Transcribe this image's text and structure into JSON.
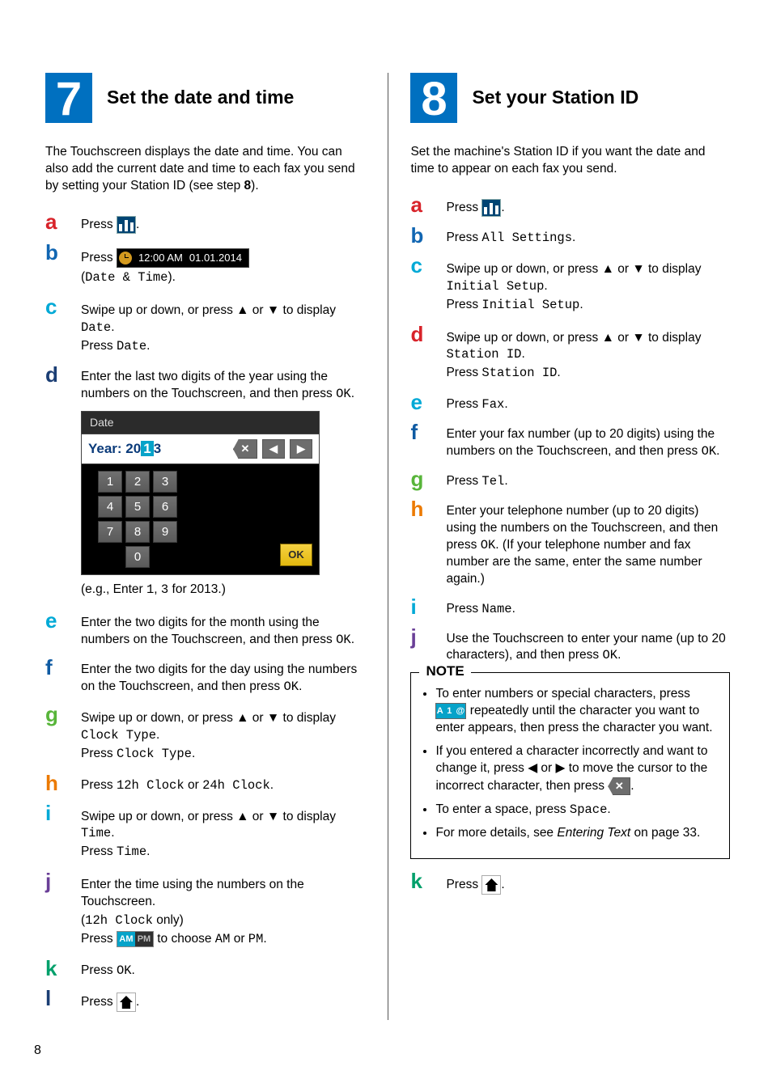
{
  "page_number": "8",
  "left": {
    "number": "7",
    "title": "Set the date and time",
    "intro_a": "The Touchscreen displays the date and time. You can also add the current date and time to each fax you send by setting your Station ID (see step ",
    "intro_bold": "8",
    "intro_b": ").",
    "steps": {
      "a": {
        "pre": "Press ",
        "post": "."
      },
      "b": {
        "pre": "Press ",
        "pill_time": "12:00 AM",
        "pill_date": "01.01.2014",
        "line2a": "(",
        "line2_mono": "Date & Time",
        "line2b": ")."
      },
      "c": {
        "line1a": "Swipe up or down, or press ▲ or ▼ to display ",
        "line1_mono": "Date",
        "line1b": ".",
        "line2a": "Press ",
        "line2_mono": "Date",
        "line2b": "."
      },
      "d": {
        "text_a": "Enter the last two digits of the year using the numbers on the Touchscreen, and then press ",
        "text_mono": "OK",
        "text_b": "."
      },
      "date_shot": {
        "title": "Date",
        "year_prefix": "Year: 20",
        "year_caret": "1",
        "year_suffix": "3",
        "keys": [
          "1",
          "2",
          "3",
          "4",
          "5",
          "6",
          "7",
          "8",
          "9",
          "0"
        ],
        "ok": "OK"
      },
      "eg": {
        "a": "(e.g., Enter ",
        "m1": "1",
        "mid": ", ",
        "m2": "3",
        "b": " for 2013.)"
      },
      "e": {
        "text_a": "Enter the two digits for the month using the numbers on the Touchscreen, and then press ",
        "text_mono": "OK",
        "text_b": "."
      },
      "f": {
        "text_a": "Enter the two digits for the day using the numbers on the Touchscreen, and then press ",
        "text_mono": "OK",
        "text_b": "."
      },
      "g": {
        "l1a": "Swipe up or down, or press ▲ or ▼ to display ",
        "l1_mono": "Clock Type",
        "l1b": ".",
        "l2a": "Press ",
        "l2_mono": "Clock Type",
        "l2b": "."
      },
      "h": {
        "a": "Press ",
        "m1": "12h Clock",
        "mid": " or ",
        "m2": "24h Clock",
        "b": "."
      },
      "i": {
        "l1a": "Swipe up or down, or press ▲ or ▼ to display ",
        "l1_mono": "Time",
        "l1b": ".",
        "l2a": "Press ",
        "l2_mono": "Time",
        "l2b": "."
      },
      "j": {
        "l1": "Enter the time using the numbers on the Touchscreen.",
        "l2a": "(",
        "l2_mono": "12h Clock",
        "l2b": " only)",
        "l3a": "Press ",
        "am": "AM",
        "pm": "PM",
        "l3b": " to choose ",
        "m1": "AM",
        "l3c": " or ",
        "m2": "PM",
        "l3d": "."
      },
      "k": {
        "a": "Press ",
        "m": "OK",
        "b": "."
      },
      "l": {
        "a": "Press ",
        "b": "."
      }
    }
  },
  "right": {
    "number": "8",
    "title": "Set your Station ID",
    "intro": "Set the machine's Station ID if you want the date and time to appear on each fax you send.",
    "steps": {
      "a": {
        "pre": "Press ",
        "post": "."
      },
      "b": {
        "a": "Press ",
        "m": "All Settings",
        "b": "."
      },
      "c": {
        "l1a": "Swipe up or down, or press ▲ or ▼ to display ",
        "l1_mono": "Initial Setup",
        "l1b": ".",
        "l2a": "Press ",
        "l2_mono": "Initial Setup",
        "l2b": "."
      },
      "d": {
        "l1a": "Swipe up or down, or press ▲ or ▼ to display ",
        "l1_mono": "Station ID",
        "l1b": ".",
        "l2a": "Press ",
        "l2_mono": "Station ID",
        "l2b": "."
      },
      "e": {
        "a": "Press ",
        "m": "Fax",
        "b": "."
      },
      "f": {
        "a": "Enter your fax number (up to 20 digits) using the numbers on the Touchscreen, and then press ",
        "m": "OK",
        "b": "."
      },
      "g": {
        "a": "Press ",
        "m": "Tel",
        "b": "."
      },
      "h": {
        "a": "Enter your telephone number (up to 20 digits) using the numbers on the Touchscreen, and then press ",
        "m": "OK",
        "b": ". (If your telephone number and fax number are the same, enter the same number again.)"
      },
      "i": {
        "a": "Press ",
        "m": "Name",
        "b": "."
      },
      "j": {
        "a": "Use the Touchscreen to enter your name (up to 20 characters), and then press ",
        "m": "OK",
        "b": "."
      },
      "k": {
        "a": "Press ",
        "b": "."
      }
    },
    "note": {
      "title": "NOTE",
      "li1a": "To enter numbers or special characters, press ",
      "li1_icon": "A 1 @",
      "li1b": " repeatedly until the character you want to enter appears, then press the character you want.",
      "li2a": "If you entered a character incorrectly and want to change it, press ◀ or ▶ to move the cursor to the incorrect character, then press ",
      "li2b": ".",
      "li3a": "To enter a space, press ",
      "li3_mono": "Space",
      "li3b": ".",
      "li4a": "For more details, see ",
      "li4_i": "Entering Text",
      "li4b": " on page 33."
    }
  }
}
